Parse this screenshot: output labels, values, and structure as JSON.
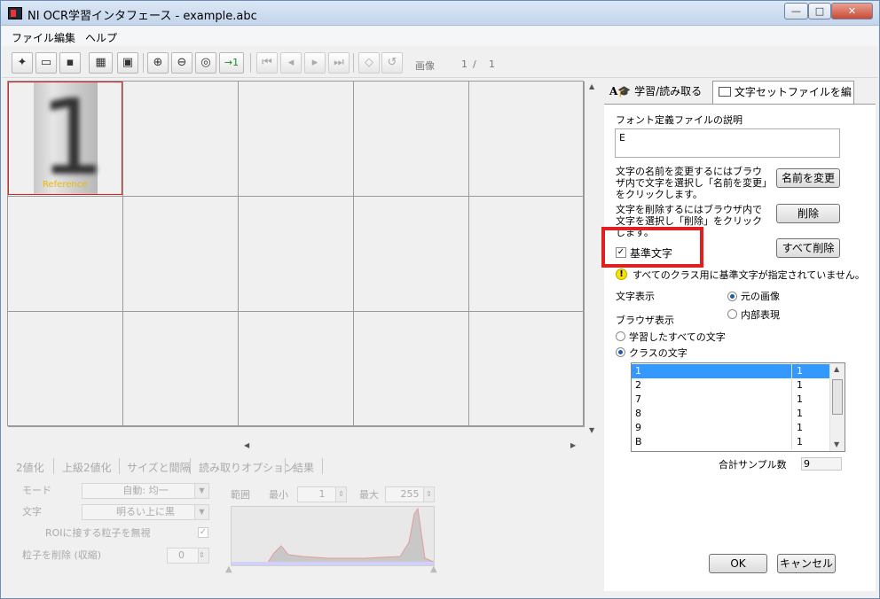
{
  "window": {
    "title": "NI OCR学習インタフェース - example.abc",
    "minimize_label": "—",
    "maximize_label": "□",
    "close_label": "✕"
  },
  "menu": [
    "ファイル",
    "編集",
    "ヘルプ"
  ],
  "toolbar": {
    "new_glyph": "✦",
    "open_glyph": "▭",
    "save_glyph": "▪",
    "image_glyph": "▦",
    "book_glyph": "▣",
    "zoom_in_glyph": "⊕",
    "zoom_out_glyph": "⊖",
    "zoom_fit_glyph": "◎",
    "zoom_1_label": "→1",
    "first_glyph": "⏮",
    "prev_glyph": "◂",
    "next_glyph": "▸",
    "last_glyph": "⏭",
    "diamond_glyph": "◇",
    "spiral_glyph": "↺",
    "image_label": "画像",
    "page_current": "1",
    "page_separator": "/",
    "page_total": "1"
  },
  "grid": {
    "reference_label": "Reference",
    "glyph": "1"
  },
  "bottom_tabs": [
    "2値化",
    "上級2値化",
    "サイズと間隔",
    "読み取りオプション",
    "結果"
  ],
  "threshold": {
    "mode_label": "モード",
    "mode_value": "自動: 均一",
    "char_label": "文字",
    "char_value": "明るい上に黒",
    "roi_label": "ROIに接する粒子を無視",
    "remove_label": "粒子を削除 (収縮)",
    "remove_value": "0",
    "range_label": "範囲",
    "min_label": "最小",
    "min_value": "1",
    "max_label": "最大",
    "max_value": "255"
  },
  "right_tabs": {
    "learn_label": "学習/読み取る",
    "edit_label": "文字セットファイルを編集"
  },
  "edit": {
    "desc_label": "フォント定義ファイルの説明",
    "desc_value": "E",
    "rename_help": "文字の名前を変更するにはブラウザ内で文字を選択し「名前を変更」をクリックします。",
    "rename_button": "名前を変更",
    "delete_help": "文字を削除するにはブラウザ内で文字を選択し「削除」をクリックします。",
    "delete_button": "削除",
    "delete_all_button": "すべて削除",
    "reference_checkbox": "基準文字",
    "warning_icon": "!",
    "warning_text": "すべてのクラス用に基準文字が指定されていません。",
    "display_label": "文字表示",
    "display_original": "元の画像",
    "display_internal": "内部表現",
    "browser_label": "ブラウザ表示",
    "browser_all": "学習したすべての文字",
    "browser_class": "クラスの文字",
    "total_label": "合計サンプル数",
    "total_value": "9"
  },
  "class_list": [
    {
      "name": "1",
      "count": "1"
    },
    {
      "name": "2",
      "count": "1"
    },
    {
      "name": "7",
      "count": "1"
    },
    {
      "name": "8",
      "count": "1"
    },
    {
      "name": "9",
      "count": "1"
    },
    {
      "name": "B",
      "count": "1"
    }
  ],
  "dialog": {
    "ok_label": "OK",
    "cancel_label": "キャンセル"
  },
  "colors": {
    "highlight_red": "#e02020",
    "selection_blue": "#3399ff",
    "reference_text": "#f0b800"
  }
}
